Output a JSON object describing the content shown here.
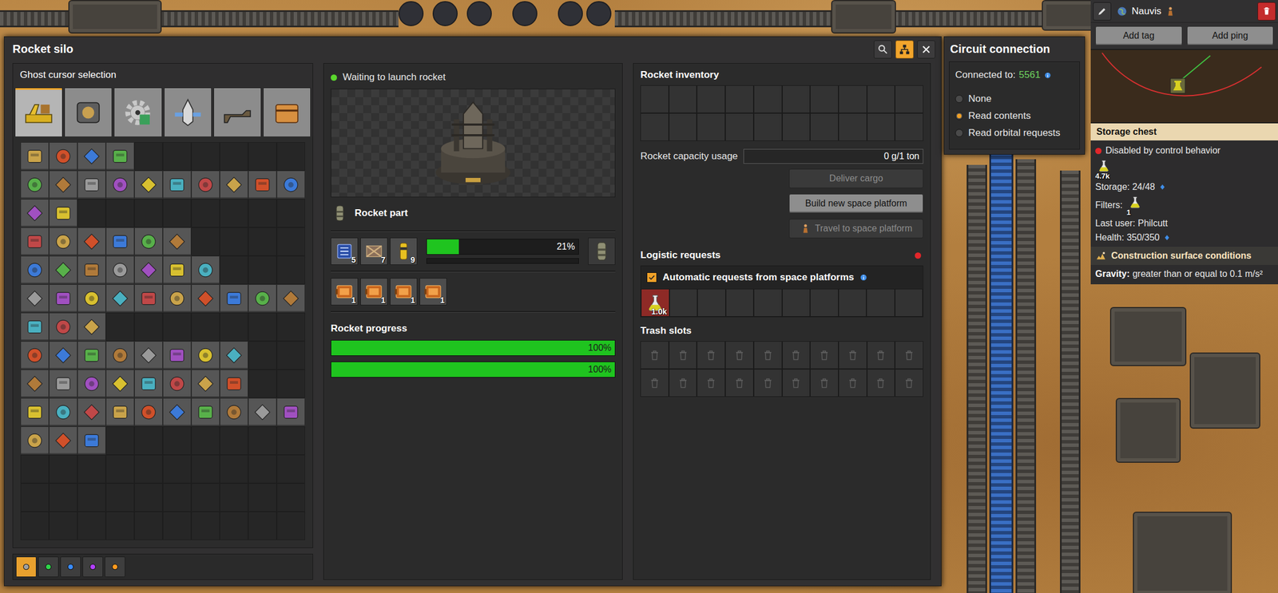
{
  "window": {
    "title": "Rocket silo",
    "title_buttons": [
      {
        "kind": "search",
        "selected": false
      },
      {
        "kind": "network",
        "selected": true
      },
      {
        "kind": "close",
        "selected": false
      }
    ]
  },
  "ghost": {
    "title": "Ghost cursor selection",
    "tabs": [
      {
        "kind": "logistics",
        "selected": true
      },
      {
        "kind": "production",
        "selected": false
      },
      {
        "kind": "intermediates",
        "selected": false
      },
      {
        "kind": "space",
        "selected": false
      },
      {
        "kind": "combat",
        "selected": false
      },
      {
        "kind": "other",
        "selected": false
      }
    ],
    "item_rows": [
      4,
      10,
      2,
      6,
      7,
      10,
      3,
      8,
      8,
      10,
      3
    ],
    "quality": [
      {
        "selected": true,
        "color": "#a0a0a0"
      },
      {
        "selected": false,
        "color": "#2fd44a"
      },
      {
        "selected": false,
        "color": "#3a8cff"
      },
      {
        "selected": false,
        "color": "#b340ff"
      },
      {
        "selected": false,
        "color": "#ff9a1f"
      }
    ]
  },
  "silo": {
    "status": {
      "text": "Waiting to launch rocket",
      "color": "#5ad62d"
    },
    "recipe": "Rocket part",
    "ingredients": [
      {
        "kind": "circuit",
        "count": "5"
      },
      {
        "kind": "structure",
        "count": "7"
      },
      {
        "kind": "fuel",
        "count": "9"
      }
    ],
    "crafting": {
      "level": 0.21,
      "reading": "21%"
    },
    "secondary": {
      "level": 0
    },
    "modules": [
      {
        "count": "1"
      },
      {
        "count": "1"
      },
      {
        "count": "1"
      },
      {
        "count": "1"
      }
    ],
    "progress_title": "Rocket progress",
    "progress": [
      {
        "level": 1,
        "reading": "100%"
      },
      {
        "level": 1,
        "reading": "100%"
      }
    ]
  },
  "inventory": {
    "title": "Rocket inventory",
    "capacity_label": "Rocket capacity usage",
    "capacity": {
      "level": 0,
      "reading": "0 g/1 ton"
    },
    "buttons": [
      {
        "label": "Deliver cargo",
        "disabled": true,
        "kind": "plain"
      },
      {
        "label": "Build new space platform",
        "disabled": false,
        "kind": "plain"
      },
      {
        "label": "Travel to space platform",
        "disabled": true,
        "kind": "travel"
      }
    ]
  },
  "logistics": {
    "title": "Logistic requests",
    "status_color": "#e2262a",
    "auto": {
      "label": "Automatic requests from space platforms",
      "checked": true
    },
    "requests": [
      {
        "count": "1.0k",
        "unsatisfied": true
      }
    ]
  },
  "trash": {
    "title": "Trash slots"
  },
  "circuit": {
    "title": "Circuit connection",
    "connected_label": "Connected to:",
    "network_id": "5561",
    "options": [
      {
        "label": "None",
        "selected": false
      },
      {
        "label": "Read contents",
        "selected": true
      },
      {
        "label": "Read orbital requests",
        "selected": false
      }
    ]
  },
  "sidebar": {
    "surface": "Nauvis",
    "buttons": [
      {
        "label": "Add tag"
      },
      {
        "label": "Add ping"
      }
    ]
  },
  "tooltip": {
    "title": "Storage chest",
    "status": {
      "text": "Disabled by control behavior",
      "color": "#e2262a"
    },
    "contents": [
      {
        "count": "4.7k"
      }
    ],
    "storage": "Storage: 24/48",
    "filters_label": "Filters:",
    "filters": [
      {
        "count": "1"
      }
    ],
    "last_user": "Last user: Philcutt",
    "health": "Health: 350/350",
    "conditions_title": "Construction surface conditions",
    "gravity_label": "Gravity:",
    "gravity_value": "greater than or equal to 0.1 m/s²"
  }
}
